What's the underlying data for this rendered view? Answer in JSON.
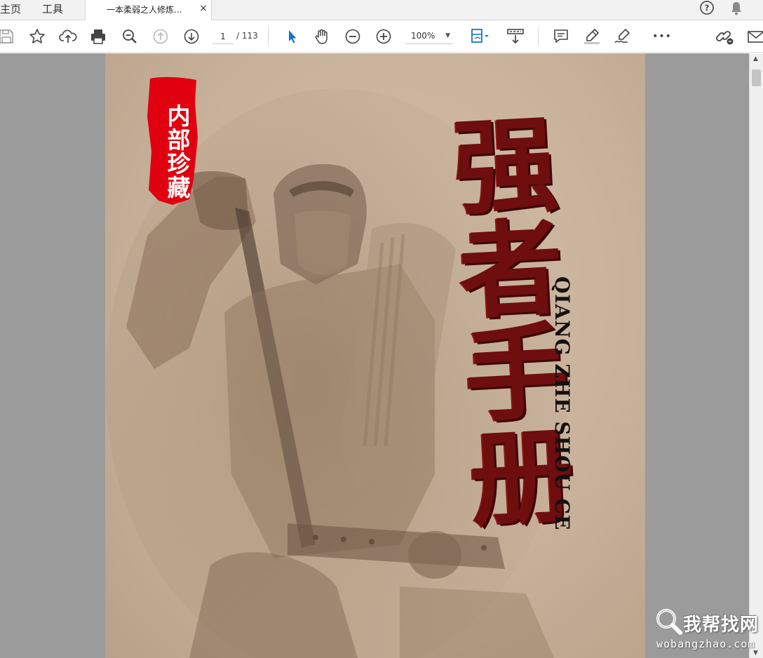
{
  "nav": {
    "home": "主页",
    "tools": "工具"
  },
  "tab": {
    "title": "一本柔弱之人修炼...",
    "close": "×"
  },
  "toolbar": {
    "page_current": "1",
    "page_total": "/ 113",
    "zoom": "100%",
    "zoom_caret": "▼",
    "more": "•••"
  },
  "document": {
    "stamp": "内部珍藏",
    "title_cn": "强者手册",
    "title_pinyin": "QIANG ZHE SHOU CE"
  },
  "scrollbar": {
    "up": "▲",
    "down": "▼"
  },
  "watermark": {
    "site": "我帮找网",
    "url": "wobangzhao.com"
  },
  "colors": {
    "accent": "#1a73c8",
    "title_red": "#6e0e0e",
    "stamp_red": "#e00010",
    "page_bg": "#c8b29b",
    "viewer_bg": "#9b9b9b"
  },
  "icons": [
    "save-icon",
    "star-icon",
    "upload-icon",
    "print-icon",
    "zoom-out-search-icon",
    "page-up-icon",
    "page-down-icon",
    "select-arrow-icon",
    "hand-icon",
    "minus-circle-icon",
    "plus-circle-icon",
    "fit-page-icon",
    "scroll-mode-icon",
    "comment-icon",
    "highlight-icon",
    "sign-icon",
    "more-icon",
    "link-icon",
    "email-icon",
    "help-icon",
    "bell-icon"
  ]
}
